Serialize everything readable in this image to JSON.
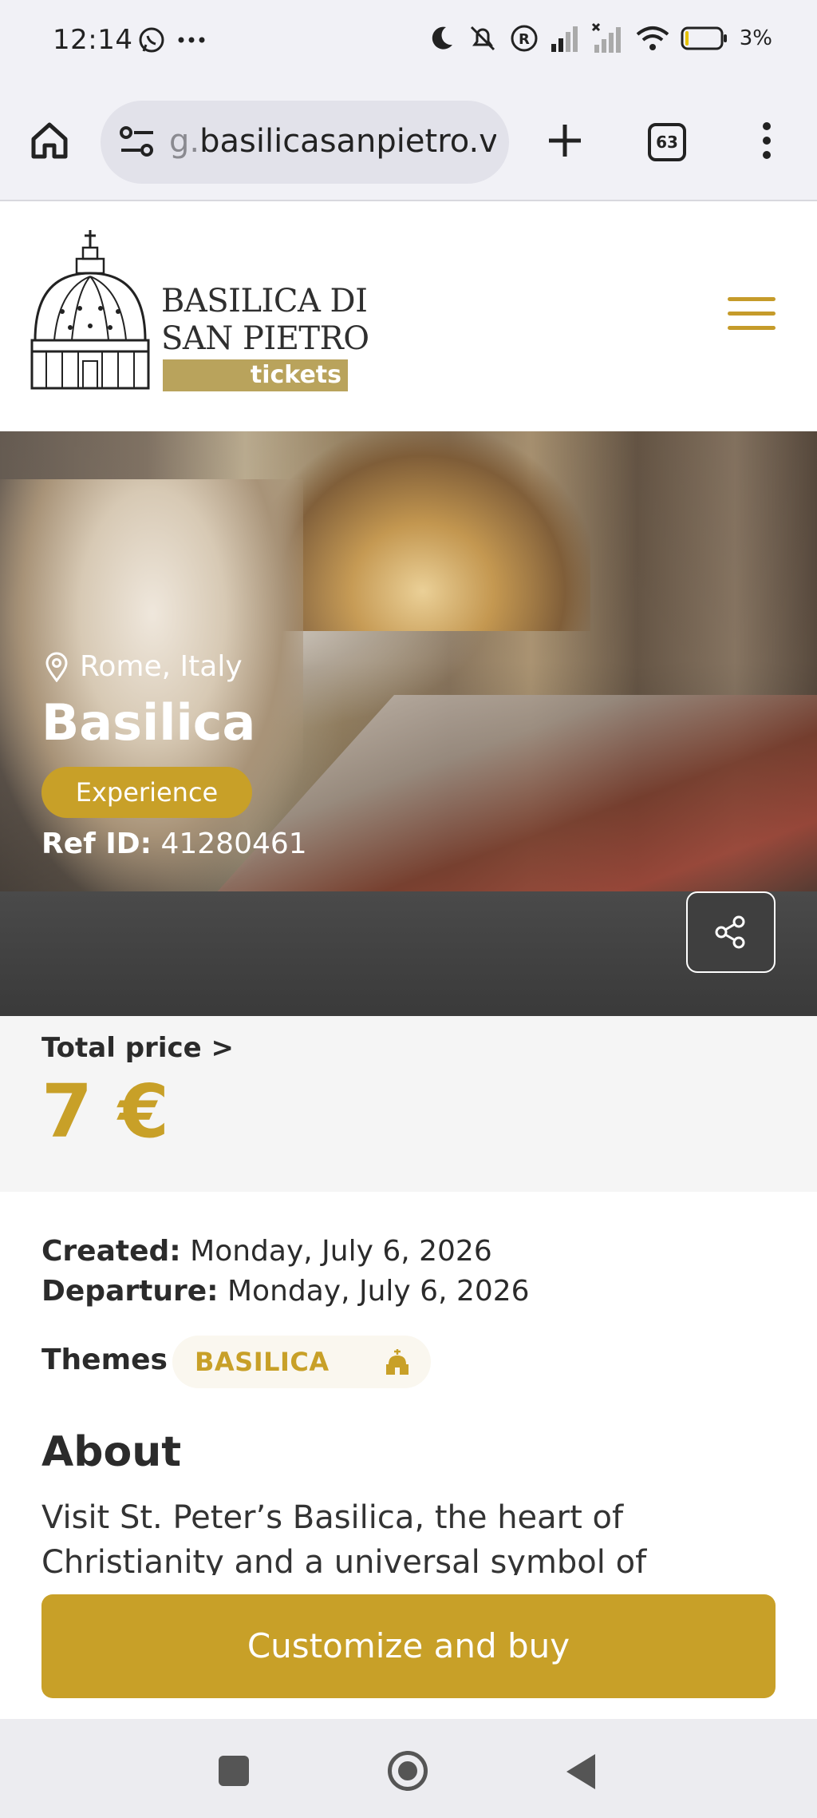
{
  "status_bar": {
    "time": "12:14",
    "battery": "3%"
  },
  "browser": {
    "url_prefix": "g.",
    "url_main": "basilicasanpietro.va",
    "tab_count": "63"
  },
  "header": {
    "logo_line1": "BASILICA DI",
    "logo_line2": "SAN PIETRO",
    "logo_tag": "tickets"
  },
  "hero": {
    "location": "Rome, Italy",
    "title": "Basilica",
    "badge": "Experience",
    "ref_label": "Ref ID:",
    "ref_value": "41280461"
  },
  "price": {
    "label": "Total price >",
    "value": "7 €"
  },
  "details": {
    "created_label": "Created:",
    "created_value": "Monday, July 6, 2026",
    "departure_label": "Departure:",
    "departure_value": "Monday, July 6, 2026",
    "themes_label": "Themes",
    "theme": "BASILICA"
  },
  "about": {
    "title": "About",
    "text": "Visit St. Peter’s Basilica, the heart of Christianity and a universal symbol of"
  },
  "cta": {
    "label": "Customize and buy"
  },
  "colors": {
    "accent": "#c8a028",
    "logo_tag": "#b9a35c",
    "dark_band": "#3f3f3f"
  }
}
